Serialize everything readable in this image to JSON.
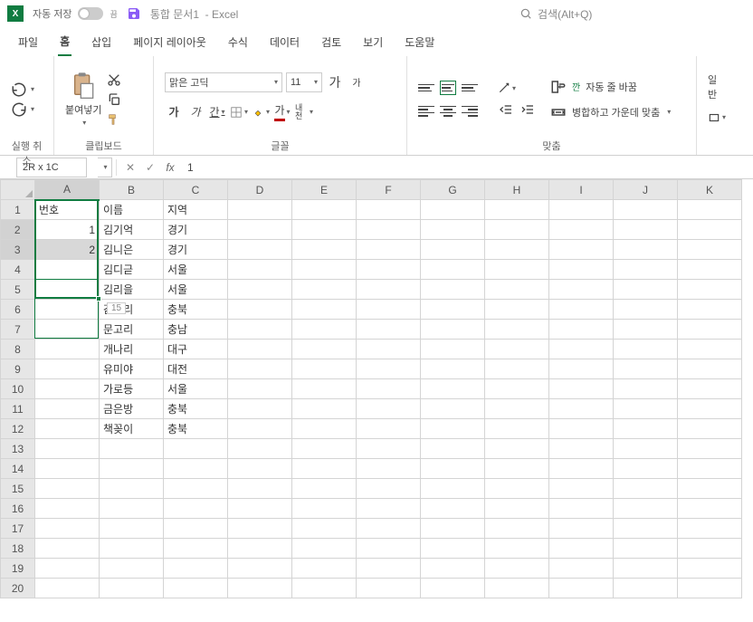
{
  "titlebar": {
    "autosave_label": "자동 저장",
    "autosave_off": "끔",
    "doc_name": "통합 문서1",
    "app_suffix": "-   Excel",
    "search_placeholder": "검색(Alt+Q)"
  },
  "menu": {
    "file": "파일",
    "home": "홈",
    "insert": "삽입",
    "page_layout": "페이지 레이아웃",
    "formulas": "수식",
    "data": "데이터",
    "review": "검토",
    "view": "보기",
    "help": "도움말"
  },
  "ribbon": {
    "undo_group": "실행 취소",
    "clipboard_group": "클립보드",
    "paste": "붙여넣기",
    "font_group": "글꼴",
    "font_name": "맑은 고딕",
    "font_size": "11",
    "font_increase": "가",
    "font_decrease": "가",
    "bold": "가",
    "italic": "가",
    "underline": "간",
    "han_char": "내천",
    "align_group": "맞춤",
    "wrap_text": "자동 줄 바꿈",
    "merge_center": "병합하고 가운데 맞춤",
    "number_group_label": "일반"
  },
  "formula_bar": {
    "name_box": "2R x 1C",
    "formula_value": "1"
  },
  "columns": [
    "A",
    "B",
    "C",
    "D",
    "E",
    "F",
    "G",
    "H",
    "I",
    "J",
    "K"
  ],
  "row_count": 20,
  "cells": {
    "A1": "번호",
    "B1": "이름",
    "C1": "지역",
    "A2": "1",
    "B2": "김기억",
    "C2": "경기",
    "A3": "2",
    "B3": "김니은",
    "C3": "경기",
    "B4": "김디귿",
    "C4": "서울",
    "B5": "김리을",
    "C5": "서울",
    "B6": "감고리",
    "C6": "충북",
    "B7": "문고리",
    "C7": "충남",
    "B8": "개나리",
    "C8": "대구",
    "B9": "유미야",
    "C9": "대전",
    "B10": "가로등",
    "C10": "서울",
    "B11": "금은방",
    "C11": "충북",
    "B12": "책꽂이",
    "C12": "충북"
  },
  "fill_preview": "15"
}
